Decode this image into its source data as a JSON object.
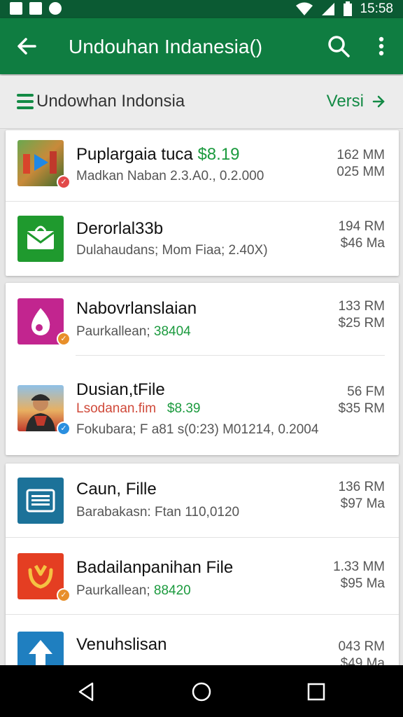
{
  "status_bar": {
    "time": "15:58"
  },
  "app_bar": {
    "title": "Undouhan Indanesia()"
  },
  "subheader": {
    "label": "Undowhan Indonsia",
    "versi_label": "Versi"
  },
  "colors": {
    "primary": "#0f7d41",
    "status_bar": "#0b5a33",
    "accent_green": "#138a45",
    "price_green": "#1b9a3e"
  },
  "items": [
    {
      "name": "Puplargaia tuca",
      "price": "$8.19",
      "subtitle": "Madkan Naban 2.3.A0., 0.2.000",
      "size_top": "162 MM",
      "size_bottom": "025 MM",
      "icon": "video-thumbnail"
    },
    {
      "name": "Derorlal33b",
      "subtitle": "Dulahaudans; Mom Fiaa; 2.40X)",
      "size_top": "194 RM",
      "size_bottom": "$46 Ma",
      "icon": "mail-icon"
    },
    {
      "name": "Nabovrlanslaian",
      "subtitle_prefix": "Paurkallean; ",
      "subtitle_price": "38404",
      "size_top": "133 RM",
      "size_bottom": "$25 RM",
      "icon": "music-drop-icon"
    },
    {
      "name": "Dusian,tFile",
      "subtitle_red": "Lsodanan.fim",
      "subtitle_red_price": "$8.39",
      "subtitle": "Fokubara; F a81 s(0:23) M01214, 0.2004",
      "size_top": "56 FM",
      "size_bottom": "$35 RM",
      "icon": "person-photo"
    },
    {
      "name": "Caun, Fille",
      "subtitle": "Barabakasn: Ftan 110,0120",
      "size_top": "136 RM",
      "size_bottom": "$97 Ma",
      "icon": "document-icon"
    },
    {
      "name": "Badailanpanihan File",
      "subtitle_prefix": "Paurkallean; ",
      "subtitle_price": "88420",
      "size_top": "1.33 MM",
      "size_bottom": "$95 Ma",
      "icon": "badge-shield-icon"
    },
    {
      "name": "Venuhslisan",
      "subtitle": "",
      "size_top": "043 RM",
      "size_bottom": "$49 Ma",
      "icon": "upload-arrow-icon"
    }
  ]
}
